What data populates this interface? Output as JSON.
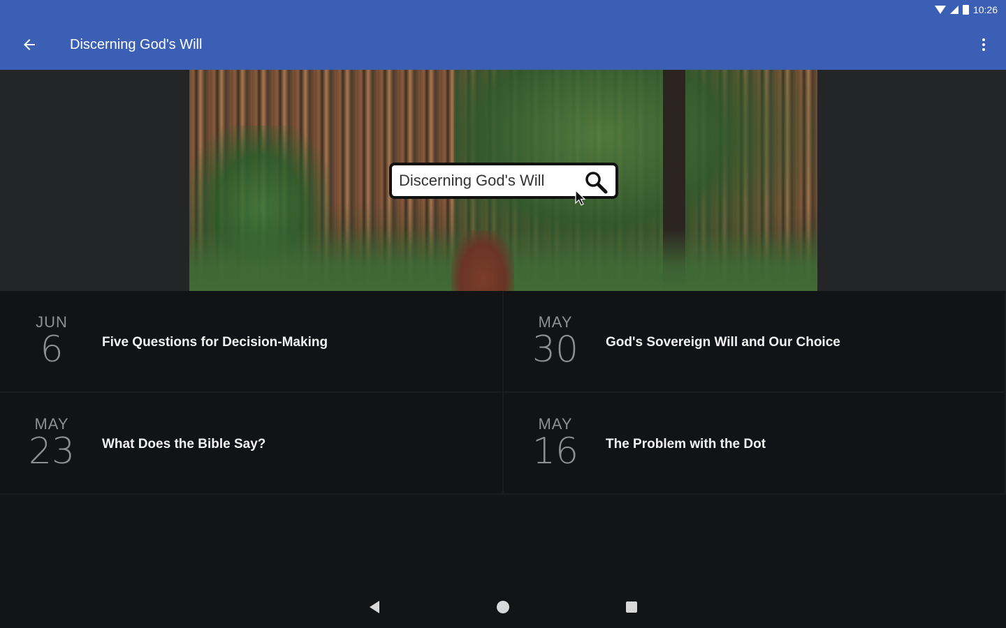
{
  "status_bar": {
    "time": "10:26",
    "icons": [
      "wifi-icon",
      "signal-icon",
      "battery-icon"
    ]
  },
  "toolbar": {
    "title": "Discerning God's Will",
    "back_icon": "arrow-back-icon",
    "overflow_icon": "more-vert-icon"
  },
  "hero": {
    "search_text": "Discerning God's Will",
    "search_icon": "search-icon",
    "cursor_icon": "mouse-pointer-icon"
  },
  "posts": [
    {
      "month": "JUN",
      "day": "6",
      "title": "Five Questions for Decision-Making"
    },
    {
      "month": "MAY",
      "day": "30",
      "title": "God's Sovereign Will and Our Choice"
    },
    {
      "month": "MAY",
      "day": "23",
      "title": "What Does the Bible Say?"
    },
    {
      "month": "MAY",
      "day": "16",
      "title": "The Problem with the Dot"
    }
  ],
  "nav_bar": {
    "icons": [
      "back-triangle-icon",
      "home-circle-icon",
      "recents-square-icon"
    ]
  },
  "colors": {
    "app_bar": "#3a5fb5",
    "background": "#131416",
    "date_text": "#8d8f93",
    "title_text": "#f1f1f1"
  }
}
